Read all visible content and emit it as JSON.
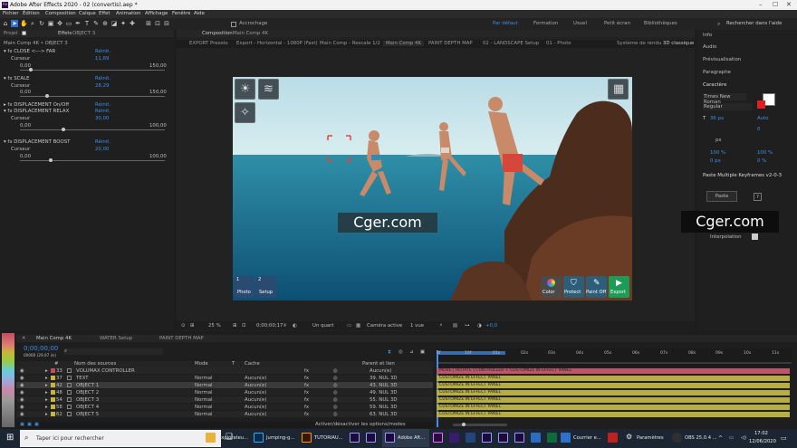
{
  "window": {
    "title": "Adobe After Effects 2020 - 02 (convertis).aep *"
  },
  "menu": [
    "Fichier",
    "Édition",
    "Composition",
    "Calque",
    "Effet",
    "Animation",
    "Affichage",
    "Fenêtre",
    "Aide"
  ],
  "toolbar": {
    "snap_label": "Accrochage",
    "workspaces": [
      "Par défaut",
      "Formation",
      "Usuel",
      "Petit écran",
      "Bibliothèques"
    ],
    "search_placeholder": "Rechercher dans l'aide"
  },
  "effects_panel": {
    "tabs": {
      "project": "Projet",
      "effects": "Effets",
      "layer": "OBJECT 3"
    },
    "subtitle": "Main Comp 4K • OBJECT 3",
    "reset": "Réinit.",
    "cursor": "Curseur",
    "items": [
      {
        "name": "CLOSE <---> FAR",
        "value": "11,69",
        "min": "0,00",
        "max": "150,00",
        "pos": 0.08
      },
      {
        "name": "SCALE",
        "value": "28,29",
        "min": "0,00",
        "max": "150,00",
        "pos": 0.19
      },
      {
        "name": "DISPLACEMENT On/Off",
        "value": "",
        "min": "",
        "max": "",
        "pos": null
      },
      {
        "name": "DISPLACEMENT RELAX",
        "value": "30,00",
        "min": "0,00",
        "max": "100,00",
        "pos": 0.3
      },
      {
        "name": "DISPLACEMENT BOOST",
        "value": "20,00",
        "min": "0,00",
        "max": "100,00",
        "pos": 0.2
      }
    ]
  },
  "comp_panel": {
    "header": "Composition",
    "comp_name": "Main Comp 4K",
    "tabs": [
      "EXPORT Presets",
      "Export - Horizontal - 1080P (Fast)",
      "Main Comp - Rescale 1/2",
      "Main Comp 4K",
      "PAINT DEPTH MAP",
      "02 - LANDSCAPE Setup",
      "01 - Photo"
    ],
    "renderer": "Système de rendu :",
    "renderer_value": "3D classique",
    "overlay": {
      "step1": "1",
      "step1_label": "Photo",
      "step2": "2",
      "step2_label": "Setup",
      "buttons": [
        "Color",
        "Protect",
        "Paint Off",
        "Export"
      ]
    },
    "watermark": "Cger.com",
    "footer": {
      "zoom": "25 %",
      "time": "0;00;00;17",
      "quality": "Un quart",
      "camera": "Caméra active",
      "views": "1 vue",
      "offset": "+0,0"
    }
  },
  "right_panel": {
    "sections": [
      "Info",
      "Audio",
      "Prévisualisation",
      "Paragraphe",
      "Caractère"
    ],
    "font": "Times New Roman",
    "style": "Regular",
    "size": "36 px",
    "leading": "Auto",
    "tracking": "0",
    "unit": "px",
    "scale_v": "100 %",
    "scale_h": "100 %",
    "baseline": "0 px",
    "tsume": "0 %",
    "plugin": "Paste Multiple Keyframes v2-0-3",
    "paste_btn": "Paste",
    "help": "?",
    "interp": "Interpolation",
    "watermark": "Cger.com"
  },
  "timeline": {
    "tabs": [
      "Main Comp 4K",
      "WATER Setup",
      "PAINT DEPTH MAP"
    ],
    "timecode": "0;00;00;00",
    "fps": "00000 (29,97 i/s)",
    "headers": {
      "num": "#",
      "name": "Nom des sources",
      "mode": "Mode",
      "t": "T",
      "cache": "Cache",
      "parent": "Parent et lien"
    },
    "ruler": [
      "0f",
      "10f",
      "01s",
      "02s",
      "03s",
      "04s",
      "05s",
      "06s",
      "07s",
      "08s",
      "09s",
      "10s",
      "11s"
    ],
    "layers": [
      {
        "num": "33",
        "name": "VOLUMAX CONTROLLER",
        "mode": "",
        "cache": "",
        "parent": "Aucun(e)",
        "bar": "MOVE | ROTATE | CONTROLLER + CUSTOMIZE IN EFFECT PANEL",
        "color": "#c0546a",
        "swatch": "#c44d5d"
      },
      {
        "num": "37",
        "name": "TEXT",
        "mode": "Normal",
        "cache": "Aucun(e)",
        "parent": "39. NUL 3D",
        "bar": "CUSTOMIZE IN EFFECT PANEL",
        "color": "#b7ae42",
        "swatch": "#c9b53a"
      },
      {
        "num": "42",
        "name": "OBJECT 1",
        "mode": "Normal",
        "cache": "Aucun(e)",
        "parent": "43. NUL 3D",
        "bar": "CUSTOMIZE IN EFFECT PANEL",
        "color": "#b7ae42",
        "swatch": "#c9b53a"
      },
      {
        "num": "48",
        "name": "OBJECT 2",
        "mode": "Normal",
        "cache": "Aucun(e)",
        "parent": "49. NUL 3D",
        "bar": "CUSTOMIZE IN EFFECT PANEL",
        "color": "#b7ae42",
        "swatch": "#c9b53a"
      },
      {
        "num": "54",
        "name": "OBJECT 3",
        "mode": "Normal",
        "cache": "Aucun(e)",
        "parent": "55. NUL 3D",
        "bar": "CUSTOMIZE IN EFFECT PANEL",
        "color": "#b7ae42",
        "swatch": "#c9b53a"
      },
      {
        "num": "58",
        "name": "OBJECT 4",
        "mode": "Normal",
        "cache": "Aucun(e)",
        "parent": "59. NUL 3D",
        "bar": "CUSTOMIZE IN EFFECT PANEL",
        "color": "#b7ae42",
        "swatch": "#c9b53a"
      },
      {
        "num": "62",
        "name": "OBJECT 5",
        "mode": "Normal",
        "cache": "Aucun(e)",
        "parent": "63. NUL 3D",
        "bar": "CUSTOMIZE IN EFFECT PANEL",
        "color": "#b7ae42",
        "swatch": "#c9b53a"
      }
    ],
    "footer": "Activer/désactiver les options/modes"
  },
  "taskbar": {
    "search_placeholder": "Taper ici pour rechercher",
    "apps": [
      "Explorateu...",
      "Jumping-g...",
      "TUTORIAU...",
      "Adobe Aft...",
      "Courrier e...",
      "Paramètres",
      "OBS 25.0.4 ..."
    ],
    "time": "17:02",
    "date": "12/06/2020"
  },
  "colors": {
    "accent": "#2d8ceb",
    "timeline_bar": "#b7ae42",
    "controller_bar": "#c0546a",
    "export_btn": "#1c9c57",
    "taskbar": "#1c2633"
  }
}
